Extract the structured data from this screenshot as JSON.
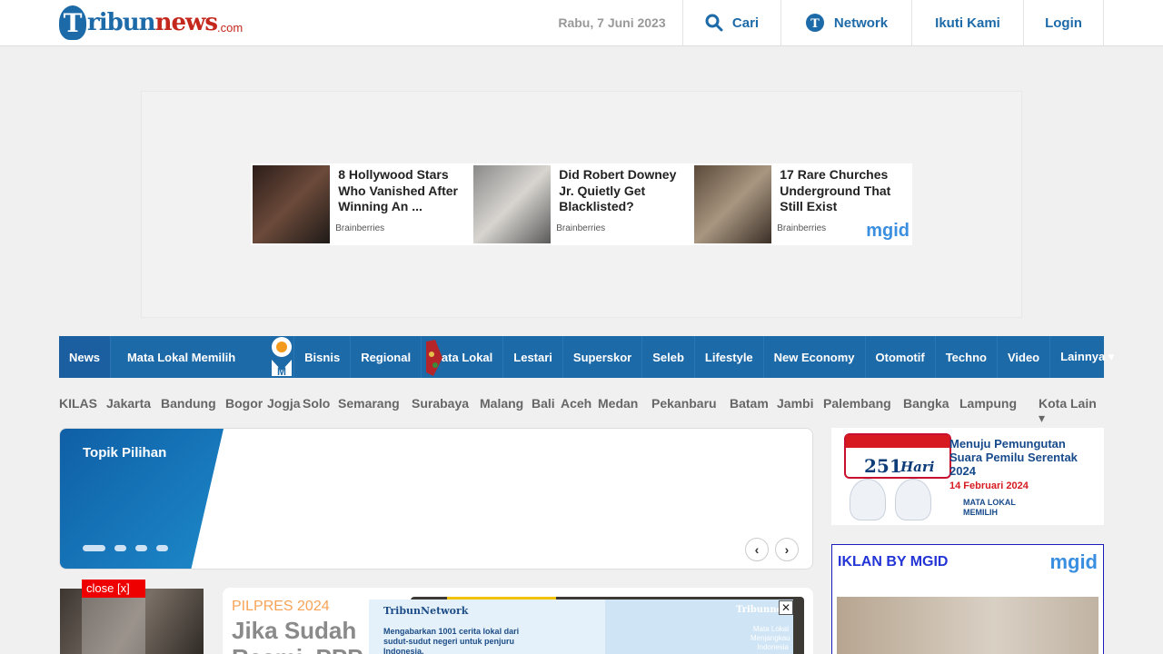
{
  "header": {
    "logo_prefix": "ribun",
    "logo_news": "news",
    "logo_domain": ".com",
    "date": "Rabu, 7 Juni 2023",
    "search_label": "Cari",
    "network_label": "Network",
    "follow_label": "Ikuti Kami",
    "login_label": "Login"
  },
  "ads": {
    "cards": [
      {
        "title": "8 Hollywood Stars Who Vanished After Winning An ...",
        "source": "Brainberries"
      },
      {
        "title": "Did Robert Downey Jr. Quietly Get Blacklisted?",
        "source": "Brainberries"
      },
      {
        "title": "17 Rare Churches Underground That Still Exist",
        "source": "Brainberries"
      }
    ],
    "mgid_label": "mgid"
  },
  "nav": {
    "items": [
      "News",
      "Mata Lokal Memilih",
      "Bisnis",
      "Regional",
      "Mata Lokal",
      "Lestari",
      "Superskor",
      "Seleb",
      "Lifestyle",
      "New Economy",
      "Otomotif",
      "Techno",
      "Video",
      "Lainnya ▾"
    ]
  },
  "cities": {
    "items": [
      "KILAS",
      "Jakarta",
      "Bandung",
      "Bogor",
      "Jogja",
      "Solo",
      "Semarang",
      "Surabaya",
      "Malang",
      "Bali",
      "Aceh",
      "Medan",
      "Pekanbaru",
      "Batam",
      "Jambi",
      "Palembang",
      "Bangka",
      "Lampung"
    ],
    "more": "Kota Lain ▾"
  },
  "topik": {
    "title": "Topik Pilihan",
    "prev": "‹",
    "next": "›"
  },
  "pemilu": {
    "days": "251",
    "hari": "Hari",
    "title": "Menuju Pemungutan Suara Pemilu Serentak 2024",
    "date": "14 Februari 2024",
    "logo": "MATA LOKAL MEMILIH"
  },
  "side_ad": {
    "title": "IKLAN BY MGID",
    "logo": "mgid"
  },
  "close_label": "close [x]",
  "article": {
    "category": "PILPRES 2024",
    "title": "Jika Sudah Resmi, PPP"
  },
  "tn_banner": {
    "brand": "TribunNetwork",
    "slogan": "Mengabarkan 1001 cerita lokal dari sudut-sudut negeri untuk penjuru Indonesia.",
    "right_brand": "Tribunnews",
    "right_slogan": "Mata Lokal Menjangkau Indonesia",
    "close": "✕"
  },
  "colors": {
    "brand_blue": "#1d6aa9",
    "brand_red": "#c4271b",
    "category_orange": "#f7a356"
  }
}
